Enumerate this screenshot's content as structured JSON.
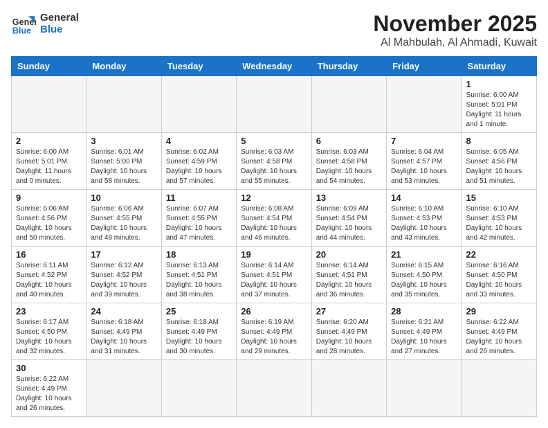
{
  "logo": {
    "line1": "General",
    "line2": "Blue"
  },
  "title": "November 2025",
  "location": "Al Mahbulah, Al Ahmadi, Kuwait",
  "weekdays": [
    "Sunday",
    "Monday",
    "Tuesday",
    "Wednesday",
    "Thursday",
    "Friday",
    "Saturday"
  ],
  "weeks": [
    [
      {
        "day": "",
        "info": ""
      },
      {
        "day": "",
        "info": ""
      },
      {
        "day": "",
        "info": ""
      },
      {
        "day": "",
        "info": ""
      },
      {
        "day": "",
        "info": ""
      },
      {
        "day": "",
        "info": ""
      },
      {
        "day": "1",
        "info": "Sunrise: 6:00 AM\nSunset: 5:01 PM\nDaylight: 11 hours\nand 1 minute."
      }
    ],
    [
      {
        "day": "2",
        "info": "Sunrise: 6:00 AM\nSunset: 5:01 PM\nDaylight: 11 hours\nand 0 minutes."
      },
      {
        "day": "3",
        "info": "Sunrise: 6:01 AM\nSunset: 5:00 PM\nDaylight: 10 hours\nand 58 minutes."
      },
      {
        "day": "4",
        "info": "Sunrise: 6:02 AM\nSunset: 4:59 PM\nDaylight: 10 hours\nand 57 minutes."
      },
      {
        "day": "5",
        "info": "Sunrise: 6:03 AM\nSunset: 4:58 PM\nDaylight: 10 hours\nand 55 minutes."
      },
      {
        "day": "6",
        "info": "Sunrise: 6:03 AM\nSunset: 4:58 PM\nDaylight: 10 hours\nand 54 minutes."
      },
      {
        "day": "7",
        "info": "Sunrise: 6:04 AM\nSunset: 4:57 PM\nDaylight: 10 hours\nand 53 minutes."
      },
      {
        "day": "8",
        "info": "Sunrise: 6:05 AM\nSunset: 4:56 PM\nDaylight: 10 hours\nand 51 minutes."
      }
    ],
    [
      {
        "day": "9",
        "info": "Sunrise: 6:06 AM\nSunset: 4:56 PM\nDaylight: 10 hours\nand 50 minutes."
      },
      {
        "day": "10",
        "info": "Sunrise: 6:06 AM\nSunset: 4:55 PM\nDaylight: 10 hours\nand 48 minutes."
      },
      {
        "day": "11",
        "info": "Sunrise: 6:07 AM\nSunset: 4:55 PM\nDaylight: 10 hours\nand 47 minutes."
      },
      {
        "day": "12",
        "info": "Sunrise: 6:08 AM\nSunset: 4:54 PM\nDaylight: 10 hours\nand 46 minutes."
      },
      {
        "day": "13",
        "info": "Sunrise: 6:09 AM\nSunset: 4:54 PM\nDaylight: 10 hours\nand 44 minutes."
      },
      {
        "day": "14",
        "info": "Sunrise: 6:10 AM\nSunset: 4:53 PM\nDaylight: 10 hours\nand 43 minutes."
      },
      {
        "day": "15",
        "info": "Sunrise: 6:10 AM\nSunset: 4:53 PM\nDaylight: 10 hours\nand 42 minutes."
      }
    ],
    [
      {
        "day": "16",
        "info": "Sunrise: 6:11 AM\nSunset: 4:52 PM\nDaylight: 10 hours\nand 40 minutes."
      },
      {
        "day": "17",
        "info": "Sunrise: 6:12 AM\nSunset: 4:52 PM\nDaylight: 10 hours\nand 39 minutes."
      },
      {
        "day": "18",
        "info": "Sunrise: 6:13 AM\nSunset: 4:51 PM\nDaylight: 10 hours\nand 38 minutes."
      },
      {
        "day": "19",
        "info": "Sunrise: 6:14 AM\nSunset: 4:51 PM\nDaylight: 10 hours\nand 37 minutes."
      },
      {
        "day": "20",
        "info": "Sunrise: 6:14 AM\nSunset: 4:51 PM\nDaylight: 10 hours\nand 36 minutes."
      },
      {
        "day": "21",
        "info": "Sunrise: 6:15 AM\nSunset: 4:50 PM\nDaylight: 10 hours\nand 35 minutes."
      },
      {
        "day": "22",
        "info": "Sunrise: 6:16 AM\nSunset: 4:50 PM\nDaylight: 10 hours\nand 33 minutes."
      }
    ],
    [
      {
        "day": "23",
        "info": "Sunrise: 6:17 AM\nSunset: 4:50 PM\nDaylight: 10 hours\nand 32 minutes."
      },
      {
        "day": "24",
        "info": "Sunrise: 6:18 AM\nSunset: 4:49 PM\nDaylight: 10 hours\nand 31 minutes."
      },
      {
        "day": "25",
        "info": "Sunrise: 6:18 AM\nSunset: 4:49 PM\nDaylight: 10 hours\nand 30 minutes."
      },
      {
        "day": "26",
        "info": "Sunrise: 6:19 AM\nSunset: 4:49 PM\nDaylight: 10 hours\nand 29 minutes."
      },
      {
        "day": "27",
        "info": "Sunrise: 6:20 AM\nSunset: 4:49 PM\nDaylight: 10 hours\nand 28 minutes."
      },
      {
        "day": "28",
        "info": "Sunrise: 6:21 AM\nSunset: 4:49 PM\nDaylight: 10 hours\nand 27 minutes."
      },
      {
        "day": "29",
        "info": "Sunrise: 6:22 AM\nSunset: 4:49 PM\nDaylight: 10 hours\nand 26 minutes."
      }
    ],
    [
      {
        "day": "30",
        "info": "Sunrise: 6:22 AM\nSunset: 4:49 PM\nDaylight: 10 hours\nand 26 minutes."
      },
      {
        "day": "",
        "info": ""
      },
      {
        "day": "",
        "info": ""
      },
      {
        "day": "",
        "info": ""
      },
      {
        "day": "",
        "info": ""
      },
      {
        "day": "",
        "info": ""
      },
      {
        "day": "",
        "info": ""
      }
    ]
  ]
}
